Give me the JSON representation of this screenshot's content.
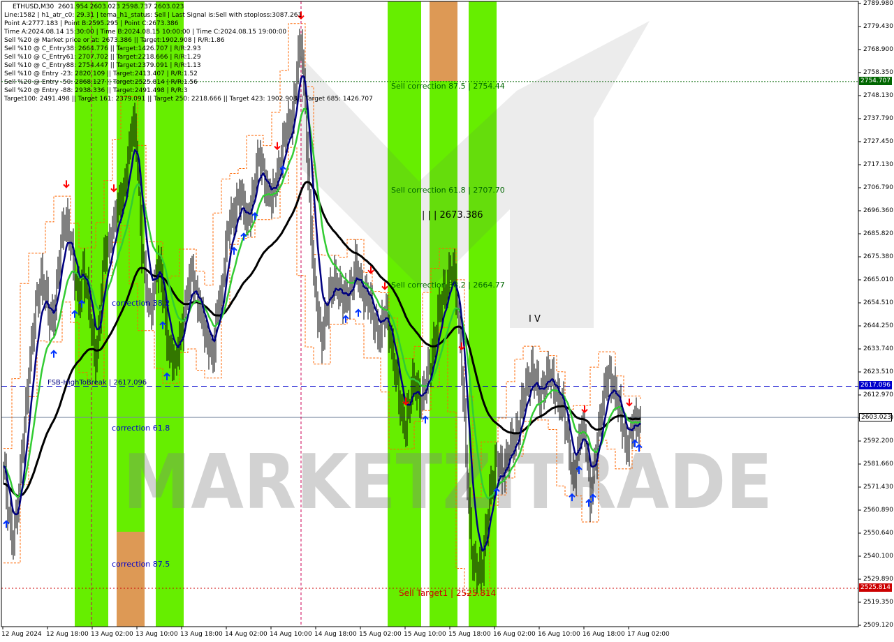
{
  "window": {
    "title_line": "ETHUSD,M30  2601.954 2603.023 2598.737 2603.023"
  },
  "info_lines": [
    "Line:1582 | h1_atr_c0: 29.31 | tema_h1_status: Sell | Last Signal is:Sell with stoploss:3087.261",
    "Point A:2777.183 | Point B:2595.295 | Point C:2673.386",
    "Time A:2024.08.14 15:30:00 | Time B:2024.08.15 10:00:00 | Time C:2024.08.15 19:00:00",
    "Sell %20 @ Market price or at: 2673.386 || Target:1902.908 | R/R:1.86",
    "Sell %10 @ C_Entry38: 2664.776 || Target:1426.707 | R/R:2.93",
    "Sell %10 @ C_Entry61: 2707.702 || Target:2218.666 | R/R:1.29",
    "Sell %10 @ C_Entry88: 2754.447 || Target:2379.091 | R/R:1.13",
    "Sell %10 @ Entry -23: 2820.109 || Target:2413.407 | R/R:1.52",
    "Sell %20 @ Entry -50: 2868.127 || Target:2525.814 | R/R:1.56",
    "Sell %20 @ Entry -88: 2938.336 || Target:2491.498 | R/R:3",
    "Target100: 2491.498 || Target 161: 2379.091 || Target 250: 2218.666 || Target 423: 1902.908 || Target 685: 1426.707"
  ],
  "chart_texts": {
    "sell_correction_875": "Sell correction 87.5 | 2754.44",
    "sell_correction_618": "Sell correction 61.8 | 2707.70",
    "sell_correction_382": "Sell correction 38.2 | 2664.77",
    "point_c_label": "| | | 2673.386",
    "wave_label": "I V",
    "correction_382": "correction 38.2",
    "correction_618": "correction 61.8",
    "correction_875": "correction 87.5",
    "fsb_label": "FSB-HighToBreak | 2617.096",
    "sell_target": "Sell Target1 | 2525.814",
    "watermark": "MARKETZITRADE"
  },
  "price_tags": {
    "sell_correction": "2754.707",
    "fsb": "2617.096",
    "current": "2603.023",
    "target": "2525.814"
  },
  "colors": {
    "green_zone": "#66ee00",
    "orange_zone": "#dd9955",
    "candle": "#000000",
    "tema_blue": "#000080",
    "ma_green": "#33cc33",
    "ma_black": "#000000",
    "envelope": "#ff6600",
    "fsb_line": "#0000cc",
    "current_line": "#7a8aa0",
    "target_line": "#cc0000",
    "sell_corr_line": "#006600",
    "buy_arrow": "#0033ff",
    "sell_arrow": "#ff0000",
    "text_green": "#006600",
    "text_blue": "#0000cc",
    "text_red": "#cc0000"
  },
  "chart_data": {
    "type": "candlestick",
    "symbol": "ETHUSD",
    "timeframe": "M30",
    "ylim": [
      2509.12,
      2789.98
    ],
    "y_ticks": [
      "2789.980",
      "2779.430",
      "2768.900",
      "2758.350",
      "2748.130",
      "2737.790",
      "2727.450",
      "2717.130",
      "2706.790",
      "2696.360",
      "2685.820",
      "2675.380",
      "2665.010",
      "2654.510",
      "2644.250",
      "2633.740",
      "2623.510",
      "2612.970",
      "2602.570",
      "2592.200",
      "2581.660",
      "2571.430",
      "2560.890",
      "2550.640",
      "2540.100",
      "2529.890",
      "2519.350",
      "2509.120"
    ],
    "x_ticks": [
      "12 Aug 2024",
      "12 Aug 18:00",
      "13 Aug 02:00",
      "13 Aug 10:00",
      "13 Aug 18:00",
      "14 Aug 02:00",
      "14 Aug 10:00",
      "14 Aug 18:00",
      "15 Aug 02:00",
      "15 Aug 10:00",
      "15 Aug 18:00",
      "16 Aug 02:00",
      "16 Aug 10:00",
      "16 Aug 18:00",
      "17 Aug 02:00"
    ],
    "levels": {
      "sell_correction_875": 2754.707,
      "fsb_high_to_break": 2617.096,
      "current_price": 2603.023,
      "sell_target1": 2525.814
    },
    "close_path": [
      [
        0,
        2581
      ],
      [
        3,
        2560
      ],
      [
        6,
        2549
      ],
      [
        9,
        2558
      ],
      [
        12,
        2575
      ],
      [
        15,
        2600
      ],
      [
        18,
        2625
      ],
      [
        21,
        2640
      ],
      [
        24,
        2655
      ],
      [
        27,
        2668
      ],
      [
        30,
        2660
      ],
      [
        33,
        2645
      ],
      [
        36,
        2650
      ],
      [
        39,
        2670
      ],
      [
        42,
        2685
      ],
      [
        45,
        2692
      ],
      [
        48,
        2685
      ],
      [
        51,
        2665
      ],
      [
        54,
        2655
      ],
      [
        57,
        2672
      ],
      [
        60,
        2660
      ],
      [
        63,
        2640
      ],
      [
        66,
        2630
      ],
      [
        69,
        2650
      ],
      [
        72,
        2675
      ],
      [
        75,
        2680
      ],
      [
        78,
        2690
      ],
      [
        81,
        2695
      ],
      [
        84,
        2700
      ],
      [
        87,
        2710
      ],
      [
        90,
        2725
      ],
      [
        93,
        2735
      ],
      [
        96,
        2720
      ],
      [
        99,
        2680
      ],
      [
        102,
        2660
      ],
      [
        105,
        2650
      ],
      [
        108,
        2665
      ],
      [
        111,
        2672
      ],
      [
        114,
        2660
      ],
      [
        117,
        2640
      ],
      [
        120,
        2630
      ],
      [
        123,
        2625
      ],
      [
        126,
        2640
      ],
      [
        129,
        2648
      ],
      [
        132,
        2660
      ],
      [
        135,
        2670
      ],
      [
        138,
        2660
      ],
      [
        141,
        2650
      ],
      [
        144,
        2640
      ],
      [
        147,
        2638
      ],
      [
        150,
        2630
      ],
      [
        153,
        2650
      ],
      [
        156,
        2660
      ],
      [
        159,
        2680
      ],
      [
        162,
        2690
      ],
      [
        165,
        2695
      ],
      [
        168,
        2705
      ],
      [
        171,
        2700
      ],
      [
        174,
        2690
      ],
      [
        177,
        2700
      ],
      [
        180,
        2710
      ],
      [
        183,
        2720
      ],
      [
        186,
        2715
      ],
      [
        189,
        2705
      ],
      [
        192,
        2700
      ],
      [
        195,
        2710
      ],
      [
        198,
        2720
      ],
      [
        201,
        2728
      ],
      [
        204,
        2735
      ],
      [
        207,
        2740
      ],
      [
        210,
        2760
      ],
      [
        213,
        2772
      ],
      [
        216,
        2745
      ],
      [
        219,
        2700
      ],
      [
        222,
        2665
      ],
      [
        225,
        2650
      ],
      [
        228,
        2640
      ],
      [
        231,
        2648
      ],
      [
        234,
        2660
      ],
      [
        237,
        2668
      ],
      [
        240,
        2660
      ],
      [
        243,
        2655
      ],
      [
        246,
        2660
      ],
      [
        249,
        2662
      ],
      [
        252,
        2670
      ],
      [
        255,
        2665
      ],
      [
        258,
        2660
      ],
      [
        261,
        2655
      ],
      [
        264,
        2650
      ],
      [
        267,
        2645
      ],
      [
        270,
        2640
      ],
      [
        273,
        2650
      ],
      [
        276,
        2645
      ],
      [
        279,
        2630
      ],
      [
        282,
        2615
      ],
      [
        285,
        2605
      ],
      [
        288,
        2600
      ],
      [
        291,
        2610
      ],
      [
        294,
        2620
      ],
      [
        297,
        2615
      ],
      [
        300,
        2610
      ],
      [
        303,
        2620
      ],
      [
        306,
        2630
      ],
      [
        309,
        2640
      ],
      [
        312,
        2650
      ],
      [
        315,
        2660
      ],
      [
        318,
        2665
      ],
      [
        321,
        2670
      ],
      [
        324,
        2660
      ],
      [
        327,
        2640
      ],
      [
        330,
        2600
      ],
      [
        333,
        2560
      ],
      [
        336,
        2540
      ],
      [
        339,
        2535
      ],
      [
        342,
        2530
      ],
      [
        345,
        2550
      ],
      [
        348,
        2570
      ],
      [
        351,
        2575
      ],
      [
        354,
        2585
      ],
      [
        357,
        2580
      ],
      [
        360,
        2582
      ],
      [
        363,
        2590
      ],
      [
        366,
        2595
      ],
      [
        369,
        2600
      ],
      [
        372,
        2610
      ],
      [
        375,
        2620
      ],
      [
        378,
        2625
      ],
      [
        381,
        2618
      ],
      [
        384,
        2612
      ],
      [
        387,
        2620
      ],
      [
        390,
        2622
      ],
      [
        393,
        2618
      ],
      [
        396,
        2615
      ],
      [
        399,
        2610
      ],
      [
        402,
        2600
      ],
      [
        405,
        2590
      ],
      [
        408,
        2575
      ],
      [
        411,
        2585
      ],
      [
        414,
        2600
      ],
      [
        417,
        2595
      ],
      [
        420,
        2565
      ],
      [
        423,
        2580
      ],
      [
        426,
        2600
      ],
      [
        429,
        2610
      ],
      [
        432,
        2620
      ],
      [
        435,
        2622
      ],
      [
        438,
        2615
      ],
      [
        441,
        2605
      ],
      [
        444,
        2595
      ],
      [
        447,
        2592
      ],
      [
        450,
        2598
      ],
      [
        453,
        2600
      ],
      [
        456,
        2603
      ]
    ],
    "annotations": [
      "Sell correction 87.5 | 2754.44",
      "Sell correction 61.8 | 2707.70",
      "Sell correction 38.2 | 2664.77",
      "| | | 2673.386",
      "I V",
      "FSB-HighToBreak | 2617.096",
      "Sell Target1 | 2525.814"
    ]
  }
}
